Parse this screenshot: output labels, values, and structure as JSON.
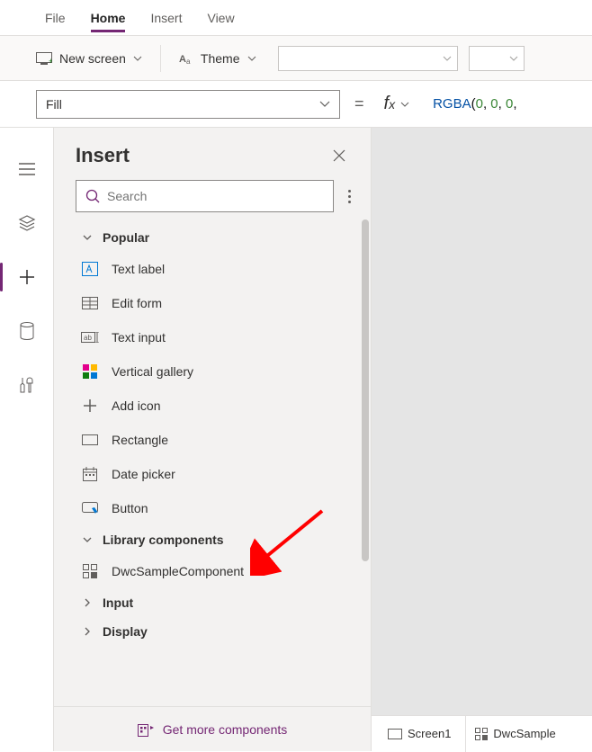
{
  "menu": {
    "tabs": [
      "File",
      "Home",
      "Insert",
      "View"
    ],
    "active": "Home"
  },
  "ribbon": {
    "new_screen": "New screen",
    "theme": "Theme"
  },
  "formula": {
    "property": "Fill",
    "fn": "RGBA",
    "args": [
      "0",
      "0",
      "0"
    ]
  },
  "panel": {
    "title": "Insert",
    "search_placeholder": "Search",
    "groups": [
      {
        "name": "Popular",
        "expanded": true,
        "items": [
          {
            "label": "Text label",
            "icon": "text-label"
          },
          {
            "label": "Edit form",
            "icon": "form"
          },
          {
            "label": "Text input",
            "icon": "text-input"
          },
          {
            "label": "Vertical gallery",
            "icon": "gallery"
          },
          {
            "label": "Add icon",
            "icon": "plus"
          },
          {
            "label": "Rectangle",
            "icon": "rect"
          },
          {
            "label": "Date picker",
            "icon": "date"
          },
          {
            "label": "Button",
            "icon": "button"
          }
        ]
      },
      {
        "name": "Library components",
        "expanded": true,
        "items": [
          {
            "label": "DwcSampleComponent",
            "icon": "component"
          }
        ]
      },
      {
        "name": "Input",
        "expanded": false,
        "items": []
      },
      {
        "name": "Display",
        "expanded": false,
        "items": []
      }
    ],
    "get_more": "Get more components"
  },
  "bottom": {
    "tabs": [
      "Screen1",
      "DwcSample"
    ]
  }
}
